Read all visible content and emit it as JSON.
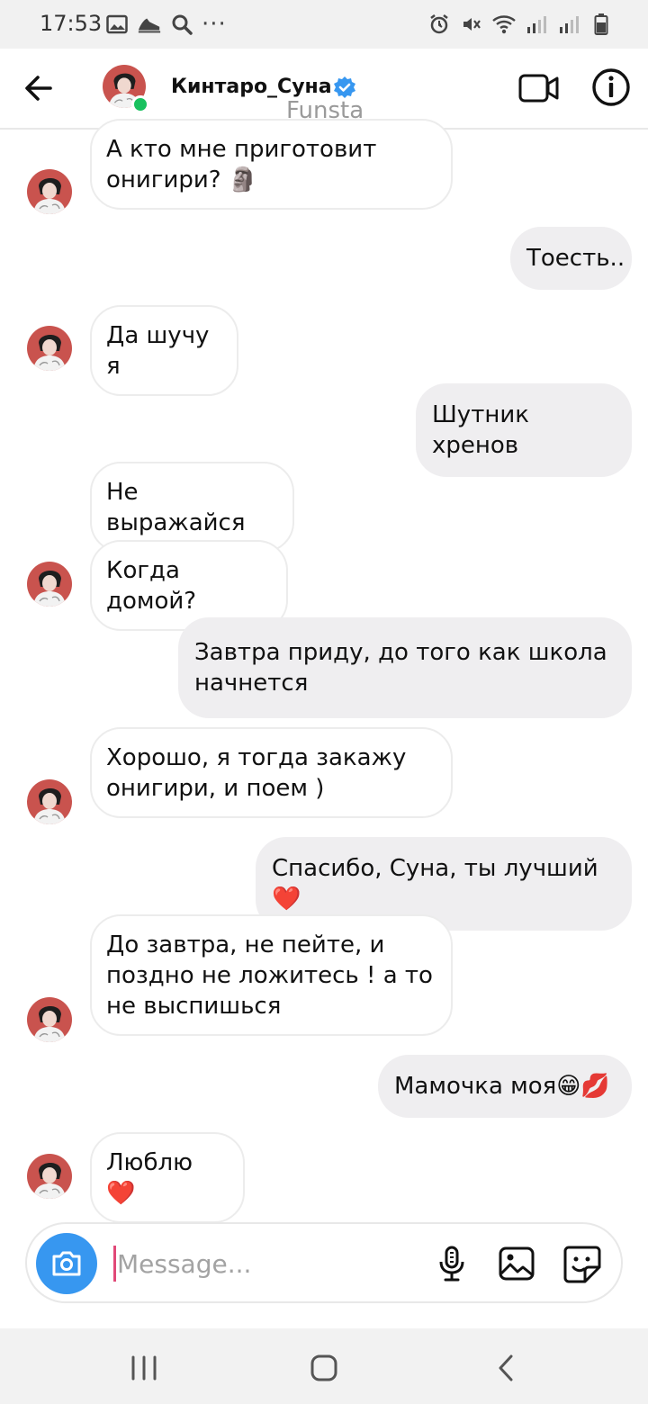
{
  "status_bar": {
    "time": "17:53",
    "left_icons": [
      "image-icon",
      "sneaker-icon",
      "search-icon"
    ],
    "overflow": "···"
  },
  "header": {
    "contact_name": "Кинтаро_Суна",
    "subtitle": "Funsta",
    "online": true
  },
  "messages": [
    {
      "side": "in",
      "text": "А кто мне приготовит онигири? 🗿"
    },
    {
      "side": "out",
      "text": "Тоесть.."
    },
    {
      "side": "in",
      "text": "Да шучу я"
    },
    {
      "side": "out",
      "text": "Шутник хренов"
    },
    {
      "side": "in",
      "text": "Не выражайся"
    },
    {
      "side": "in",
      "text": "Когда домой?"
    },
    {
      "side": "out",
      "text": "Завтра приду, до того как школа начнется"
    },
    {
      "side": "in",
      "text": "Хорошо, я тогда закажу онигири, и поем )"
    },
    {
      "side": "out",
      "text": "Спасибо, Суна, ты лучший ❤️"
    },
    {
      "side": "in",
      "text": "До завтра, не пейте, и поздно не ложитесь ! а то не выспишься"
    },
    {
      "side": "out",
      "text": "Мамочка моя😁💋"
    },
    {
      "side": "in",
      "text": "Люблю ❤️"
    }
  ],
  "composer": {
    "placeholder": "Message..."
  },
  "colors": {
    "accent_blue": "#3797f0",
    "outgoing_bubble": "#efeef0",
    "online_dot": "#19c15f",
    "avatar_bg": "#c9534e"
  }
}
